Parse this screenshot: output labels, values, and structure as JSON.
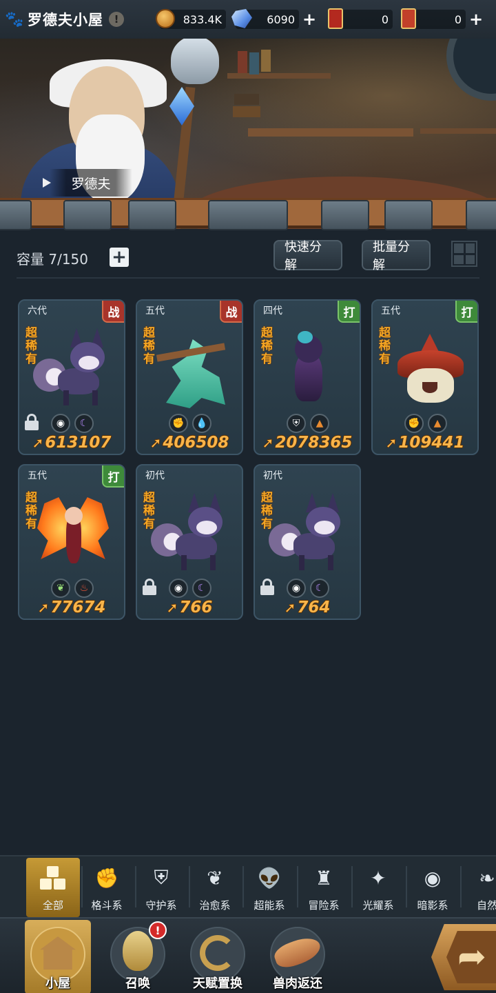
{
  "header": {
    "title": "罗德夫小屋",
    "info_glyph": "!",
    "resources": [
      {
        "name": "coins",
        "value": "833.4K"
      },
      {
        "name": "crystals",
        "value": "6090"
      },
      {
        "name": "red-ticket",
        "value": "0"
      },
      {
        "name": "gold-ticket",
        "value": "0"
      }
    ]
  },
  "banner": {
    "npc_name": "罗德夫"
  },
  "inventory": {
    "capacity_label": "容量 7/150",
    "quick_decompose": "快速分解",
    "batch_decompose": "批量分解",
    "pets": [
      {
        "generation": "六代",
        "type": "战",
        "rarity": "超稀有",
        "locked": true,
        "elements": [
          "eye",
          "moon"
        ],
        "power": "613107"
      },
      {
        "generation": "五代",
        "type": "战",
        "rarity": "超稀有",
        "locked": false,
        "elements": [
          "fist",
          "drop"
        ],
        "power": "406508"
      },
      {
        "generation": "四代",
        "type": "打",
        "rarity": "超稀有",
        "locked": false,
        "elements": [
          "shield",
          "boot"
        ],
        "power": "2078365"
      },
      {
        "generation": "五代",
        "type": "打",
        "rarity": "超稀有",
        "locked": false,
        "elements": [
          "fist",
          "boot"
        ],
        "power": "109441"
      },
      {
        "generation": "五代",
        "type": "打",
        "rarity": "超稀有",
        "locked": false,
        "elements": [
          "sprout",
          "fire"
        ],
        "power": "77674"
      },
      {
        "generation": "初代",
        "type": "",
        "rarity": "超稀有",
        "locked": true,
        "elements": [
          "eye",
          "moon"
        ],
        "power": "766"
      },
      {
        "generation": "初代",
        "type": "",
        "rarity": "超稀有",
        "locked": true,
        "elements": [
          "eye",
          "moon"
        ],
        "power": "764"
      }
    ]
  },
  "categories": [
    {
      "label": "全部",
      "icon": "all-tiles-icon",
      "active": true
    },
    {
      "label": "格斗系",
      "icon": "fist-icon"
    },
    {
      "label": "守护系",
      "icon": "shield-icon"
    },
    {
      "label": "治愈系",
      "icon": "sprout-icon"
    },
    {
      "label": "超能系",
      "icon": "alien-icon"
    },
    {
      "label": "冒险系",
      "icon": "helmet-icon"
    },
    {
      "label": "光耀系",
      "icon": "star-icon"
    },
    {
      "label": "暗影系",
      "icon": "eye-icon"
    },
    {
      "label": "自然",
      "icon": "leaf-icon"
    }
  ],
  "nav": [
    {
      "label": "小屋",
      "icon": "house-icon",
      "active": true
    },
    {
      "label": "召唤",
      "icon": "egg-icon",
      "badge": "!"
    },
    {
      "label": "天赋置换",
      "icon": "swap-icon"
    },
    {
      "label": "兽肉返还",
      "icon": "meat-icon"
    }
  ],
  "colors": {
    "background": "#1b242d",
    "rarity": "#f5a623",
    "power": "#f8b44a",
    "type_red": "#a8342a",
    "type_green": "#3e8a3a",
    "active_tab": "#c69a36"
  }
}
